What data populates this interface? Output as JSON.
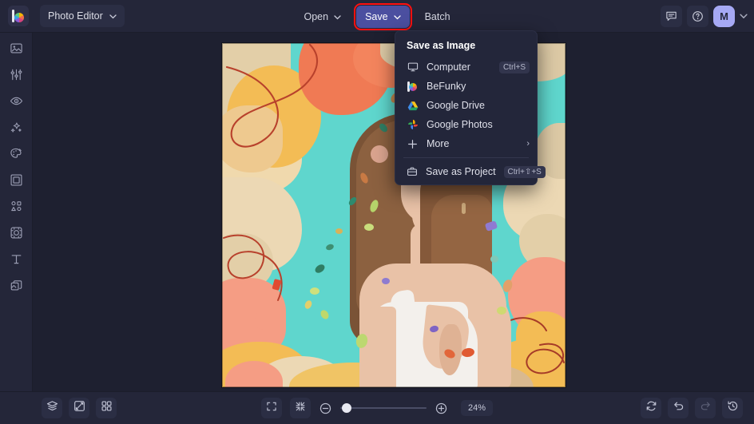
{
  "app": {
    "logo_icon": "befunky-logo-icon",
    "switcher_label": "Photo Editor",
    "switcher_chevron": "chevron-down-icon"
  },
  "topbar": {
    "menus": [
      {
        "label": "Open",
        "chevron": "chevron-down-icon",
        "active": false
      },
      {
        "label": "Save",
        "chevron": "chevron-down-icon",
        "active": true
      },
      {
        "label": "Batch",
        "chevron": "",
        "active": false
      }
    ],
    "right": {
      "feedback_icon": "chat-bubble-icon",
      "help_icon": "question-circle-icon",
      "avatar_initial": "M",
      "avatar_chevron": "chevron-down-icon"
    }
  },
  "sidebar": {
    "items": [
      {
        "name": "edit",
        "icon": "image-icon"
      },
      {
        "name": "touch-up",
        "icon": "sliders-icon"
      },
      {
        "name": "retouch",
        "icon": "eye-icon"
      },
      {
        "name": "effects",
        "icon": "sparkles-icon"
      },
      {
        "name": "artsy",
        "icon": "palette-icon"
      },
      {
        "name": "frames",
        "icon": "frame-icon"
      },
      {
        "name": "graphics",
        "icon": "shapes-icon"
      },
      {
        "name": "textures",
        "icon": "texture-icon"
      },
      {
        "name": "text",
        "icon": "text-t-icon"
      },
      {
        "name": "layers",
        "icon": "layers-copy-icon"
      }
    ]
  },
  "save_menu": {
    "title": "Save as Image",
    "items": [
      {
        "label": "Computer",
        "icon": "monitor-icon",
        "shortcut": "Ctrl+S",
        "arrow": ""
      },
      {
        "label": "BeFunky",
        "icon": "befunky-logo-icon",
        "shortcut": "",
        "arrow": ""
      },
      {
        "label": "Google Drive",
        "icon": "google-drive-icon",
        "shortcut": "",
        "arrow": ""
      },
      {
        "label": "Google Photos",
        "icon": "google-photos-icon",
        "shortcut": "",
        "arrow": ""
      },
      {
        "label": "More",
        "icon": "plus-icon",
        "shortcut": "",
        "arrow": "›"
      }
    ],
    "project": {
      "label": "Save as Project",
      "icon": "briefcase-icon",
      "shortcut": "Ctrl+⇧+S"
    }
  },
  "bottombar": {
    "left": [
      {
        "name": "layers-panel",
        "icon": "layers-stack-icon"
      },
      {
        "name": "compare-view",
        "icon": "compare-split-icon"
      },
      {
        "name": "thumbnails",
        "icon": "grid-four-icon"
      }
    ],
    "center": {
      "fullscreen_icon": "fullscreen-icon",
      "fit-screen_icon": "fit-to-screen-icon",
      "zoom_out_icon": "minus-circle-icon",
      "zoom_in_icon": "plus-circle-icon",
      "zoom_level": "24%",
      "slider_value": 2
    },
    "right": [
      {
        "name": "reset",
        "icon": "refresh-icon",
        "dim": false
      },
      {
        "name": "undo",
        "icon": "undo-arrow-icon",
        "dim": false
      },
      {
        "name": "redo",
        "icon": "redo-arrow-icon",
        "dim": true
      },
      {
        "name": "history",
        "icon": "history-clock-icon",
        "dim": false
      }
    ]
  },
  "colors": {
    "topbar_bg": "#242639",
    "stage_bg": "#1e2030",
    "accent_active": "#4b4fa0",
    "highlight_outline": "#ff1010",
    "avatar_bg": "#a6a9f4",
    "menu_bg": "#23263a",
    "canvas_teal": "#5fd6cd"
  },
  "canvas": {
    "image_description": "Woman in white tank top in profile against teal background with abstract paper-cut shapes and confetti"
  }
}
